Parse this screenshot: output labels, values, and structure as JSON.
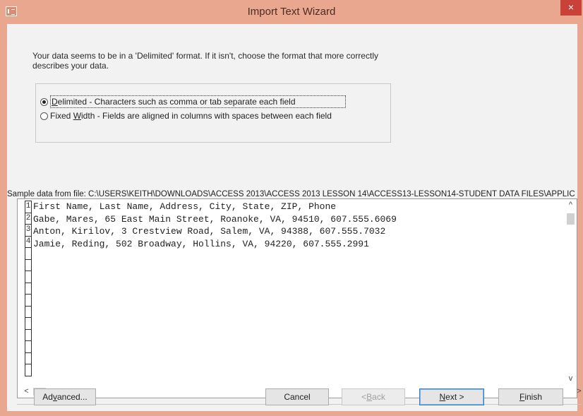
{
  "window": {
    "title": "Import Text Wizard",
    "close_glyph": "×"
  },
  "intro": {
    "line1": "Your data seems to be in a 'Delimited' format. If it isn't, choose the format that more correctly",
    "line2": "describes your data."
  },
  "format": {
    "delimited_label_pre": "D",
    "delimited_label_rest": "elimited - Characters such as comma or tab separate each field",
    "fixed_label_pre": "Fixed ",
    "fixed_label_u": "W",
    "fixed_label_rest": "idth - Fields are aligned in columns with spaces between each field",
    "selected": "Delimited"
  },
  "sample": {
    "label": "Sample data from file: C:\\USERS\\KEITH\\DOWNLOADS\\ACCESS 2013\\ACCESS 2013 LESSON 14\\ACCESS13-LESSON14-STUDENT DATA FILES\\APPLIC",
    "row_numbers": [
      "1",
      "2",
      "3",
      "4",
      "",
      "",
      "",
      "",
      "",
      "",
      "",
      "",
      "",
      "",
      ""
    ],
    "lines": [
      "First Name, Last Name, Address, City, State, ZIP, Phone",
      "Gabe, Mares, 65 East Main Street, Roanoke, VA, 94510, 607.555.6069",
      "Anton, Kirilov, 3 Crestview Road, Salem, VA, 94388, 607.555.7032",
      "Jamie, Reding, 502 Broadway, Hollins, VA, 94220, 607.555.2991"
    ]
  },
  "scroll": {
    "up": "^",
    "down": "v",
    "left": "<",
    "right": ">"
  },
  "buttons": {
    "advanced_pre": "Ad",
    "advanced_u": "v",
    "advanced_rest": "anced...",
    "cancel": "Cancel",
    "back_pre": "< ",
    "back_u": "B",
    "back_rest": "ack",
    "next_u": "N",
    "next_rest": "ext >",
    "finish_u": "F",
    "finish_rest": "inish"
  }
}
